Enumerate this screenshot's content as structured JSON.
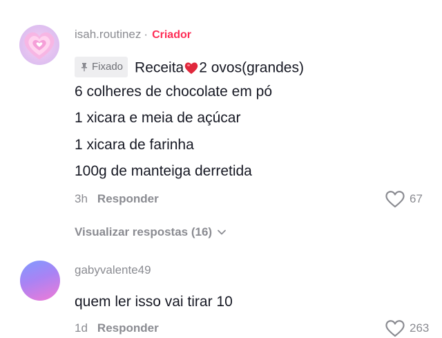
{
  "comments": [
    {
      "username": "isah.routinez",
      "separator": "·",
      "creator_badge": "Criador",
      "pinned_label": "Fixado",
      "text_lines": [
        "Receita",
        "2 ovos(grandes)",
        "6 colheres de chocolate em pó",
        "1 xicara e meia de açúcar",
        "1 xicara de farinha",
        "100g de manteiga derretida"
      ],
      "time": "3h",
      "reply_label": "Responder",
      "likes": "67",
      "view_replies": "Visualizar respostas (16)"
    },
    {
      "username": "gabyvalente49",
      "text_lines": [
        "quem ler isso vai tirar 10"
      ],
      "time": "1d",
      "reply_label": "Responder",
      "likes": "263"
    }
  ],
  "colors": {
    "accent": "#fe2c55",
    "secondary_text": "#8a8b91",
    "primary_text": "#161823"
  },
  "icons": {
    "pin": "pin-icon",
    "heart_emoji": "red-heart-emoji",
    "like": "heart-outline-icon",
    "chevron": "chevron-down-icon"
  }
}
